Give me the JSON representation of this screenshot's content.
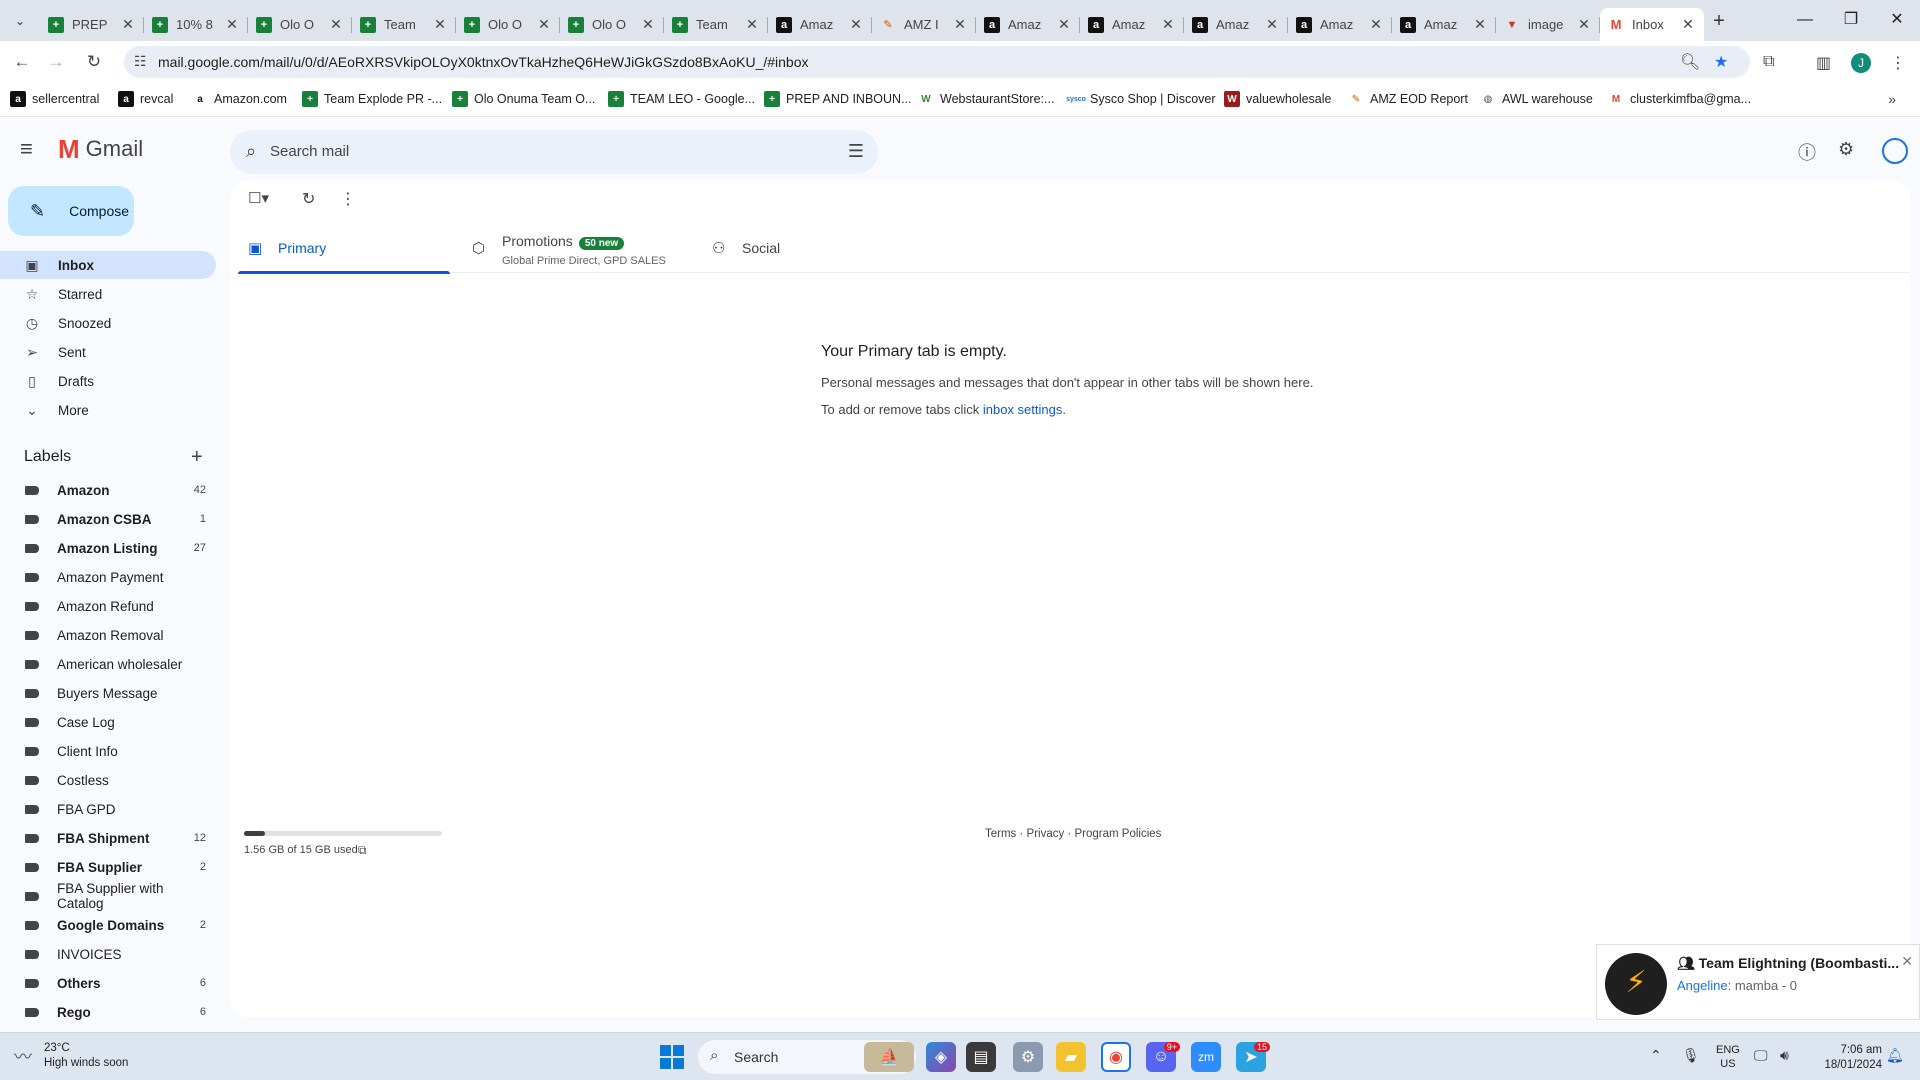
{
  "browser": {
    "tabs": [
      {
        "title": "PREP",
        "icon": "sheets-icon"
      },
      {
        "title": "10% 8",
        "icon": "sheets-icon"
      },
      {
        "title": "Olo O",
        "icon": "sheets-icon"
      },
      {
        "title": "Team",
        "icon": "sheets-icon"
      },
      {
        "title": "Olo O",
        "icon": "sheets-icon"
      },
      {
        "title": "Olo O",
        "icon": "sheets-icon"
      },
      {
        "title": "Team",
        "icon": "sheets-icon"
      },
      {
        "title": "Amaz",
        "icon": "amazon-icon"
      },
      {
        "title": "AMZ I",
        "icon": "pencil-icon"
      },
      {
        "title": "Amaz",
        "icon": "amazon-icon"
      },
      {
        "title": "Amaz",
        "icon": "amazon-icon"
      },
      {
        "title": "Amaz",
        "icon": "amazon-icon"
      },
      {
        "title": "Amaz",
        "icon": "amazon-icon"
      },
      {
        "title": "Amaz",
        "icon": "amazon-icon"
      },
      {
        "title": "image",
        "icon": "v-icon"
      },
      {
        "title": "Inbox",
        "icon": "gmail-icon",
        "active": true
      }
    ],
    "url": "mail.google.com/mail/u/0/d/AEoRXRSVkipOLOyX0ktnxOvTkaHzheQ6HeWJiGkGSzdo8BxAoKU_/#inbox",
    "profile_initial": "J",
    "bookmarks": [
      {
        "label": "sellercentral",
        "icon": "amazon-icon"
      },
      {
        "label": "revcal",
        "icon": "amazon-icon"
      },
      {
        "label": "Amazon.com",
        "icon": "amazon-logo-icon"
      },
      {
        "label": "Team Explode PR -...",
        "icon": "sheets-icon"
      },
      {
        "label": "Olo Onuma Team O...",
        "icon": "sheets-icon"
      },
      {
        "label": "TEAM LEO - Google...",
        "icon": "sheets-icon"
      },
      {
        "label": "PREP AND INBOUN...",
        "icon": "sheets-icon"
      },
      {
        "label": "WebstaurantStore:...",
        "icon": "webstaurant-icon"
      },
      {
        "label": "Sysco Shop | Discover",
        "icon": "sysco-icon"
      },
      {
        "label": "valuewholesale",
        "icon": "vw-icon"
      },
      {
        "label": "AMZ EOD Report",
        "icon": "pencil-icon"
      },
      {
        "label": "AWL warehouse",
        "icon": "globe-icon"
      },
      {
        "label": "clusterkimfba@gma...",
        "icon": "gmail-icon"
      }
    ]
  },
  "gmail": {
    "brand": "Gmail",
    "search_placeholder": "Search mail",
    "compose_label": "Compose",
    "nav": [
      {
        "label": "Inbox",
        "icon": "inbox-icon",
        "active": true
      },
      {
        "label": "Starred",
        "icon": "star-icon"
      },
      {
        "label": "Snoozed",
        "icon": "clock-icon"
      },
      {
        "label": "Sent",
        "icon": "send-icon"
      },
      {
        "label": "Drafts",
        "icon": "draft-icon"
      },
      {
        "label": "More",
        "icon": "chevron-down-icon"
      }
    ],
    "labels_heading": "Labels",
    "labels": [
      {
        "name": "Amazon",
        "count": "42",
        "bold": true
      },
      {
        "name": "Amazon CSBA",
        "count": "1",
        "bold": true
      },
      {
        "name": "Amazon Listing",
        "count": "27",
        "bold": true
      },
      {
        "name": "Amazon Payment",
        "count": "",
        "bold": false
      },
      {
        "name": "Amazon Refund",
        "count": "",
        "bold": false
      },
      {
        "name": "Amazon Removal",
        "count": "",
        "bold": false
      },
      {
        "name": "American wholesaler",
        "count": "",
        "bold": false
      },
      {
        "name": "Buyers Message",
        "count": "",
        "bold": false
      },
      {
        "name": "Case Log",
        "count": "",
        "bold": false
      },
      {
        "name": "Client Info",
        "count": "",
        "bold": false
      },
      {
        "name": "Costless",
        "count": "",
        "bold": false
      },
      {
        "name": "FBA GPD",
        "count": "",
        "bold": false
      },
      {
        "name": "FBA Shipment",
        "count": "12",
        "bold": true
      },
      {
        "name": "FBA Supplier",
        "count": "2",
        "bold": true
      },
      {
        "name": "FBA Supplier with Catalog",
        "count": "",
        "bold": false
      },
      {
        "name": "Google Domains",
        "count": "2",
        "bold": true
      },
      {
        "name": "INVOICES",
        "count": "",
        "bold": false
      },
      {
        "name": "Others",
        "count": "6",
        "bold": true
      },
      {
        "name": "Rego",
        "count": "6",
        "bold": true
      }
    ],
    "category_tabs": {
      "primary": "Primary",
      "promotions": "Promotions",
      "promotions_badge": "50 new",
      "promotions_sub": "Global Prime Direct, GPD SALES",
      "social": "Social"
    },
    "empty_state": {
      "heading": "Your Primary tab is empty.",
      "line1": "Personal messages and messages that don't appear in other tabs will be shown here.",
      "line2_prefix": "To add or remove tabs click ",
      "line2_link": "inbox settings",
      "line2_suffix": "."
    },
    "storage": {
      "text": "1.56 GB of 15 GB used",
      "fraction": 0.104
    },
    "footer": {
      "terms": "Terms",
      "privacy": "Privacy",
      "policies": "Program Policies",
      "sep": " · "
    }
  },
  "chat_notification": {
    "title": "Team Elightning (Boombasti...",
    "sender": "Angeline:",
    "message": " mamba - 0"
  },
  "taskbar": {
    "temperature": "23°C",
    "weather_text": "High winds soon",
    "search_placeholder": "Search",
    "discord_badge": "9+",
    "telegram_badge": "15",
    "lang_line1": "ENG",
    "lang_line2": "US",
    "time": "7:06 am",
    "date": "18/01/2024"
  },
  "colors": {
    "accent": "#0b57d0",
    "compose_bg": "#c2e7ff",
    "active_nav": "#d3e3fd",
    "promo_badge": "#188038"
  }
}
